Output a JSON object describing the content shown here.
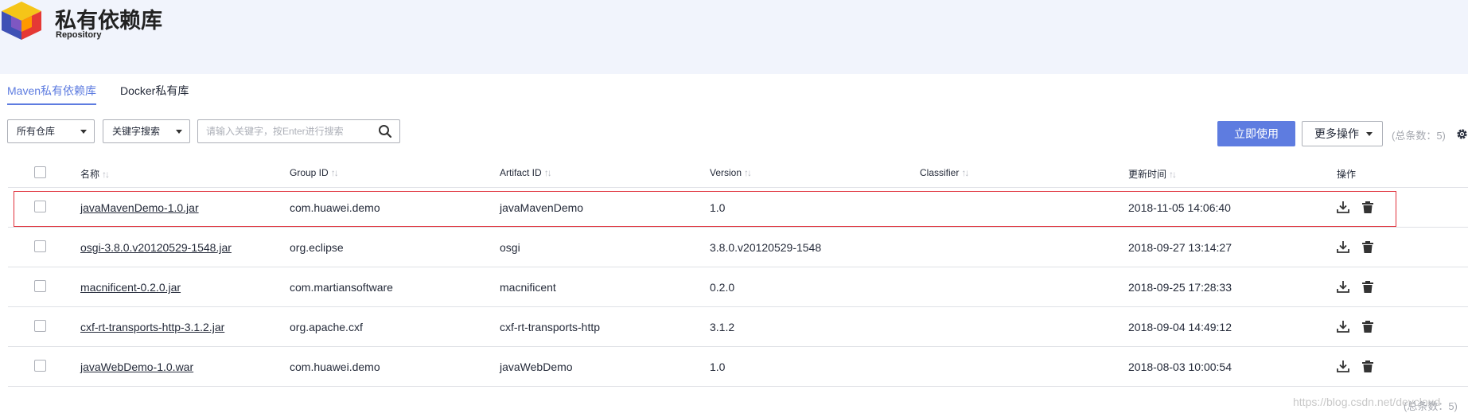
{
  "header": {
    "title": "私有依赖库",
    "subtitle": "Repository"
  },
  "tabs": [
    {
      "label": "Maven私有依赖库",
      "active": true
    },
    {
      "label": "Docker私有库",
      "active": false
    }
  ],
  "filters": {
    "repo_select": "所有仓库",
    "search_type_select": "关键字搜索",
    "search_placeholder": "请输入关键字，按Enter进行搜索"
  },
  "toolbar": {
    "primary_label": "立即使用",
    "more_label": "更多操作",
    "total_label": "(总条数：5)"
  },
  "table": {
    "columns": [
      "名称",
      "Group ID",
      "Artifact ID",
      "Version",
      "Classifier",
      "更新时间",
      "操作"
    ],
    "rows": [
      {
        "name": "javaMavenDemo-1.0.jar",
        "group": "com.huawei.demo",
        "artifact": "javaMavenDemo",
        "version": "1.0",
        "classifier": "",
        "updated": "2018-11-05 14:06:40"
      },
      {
        "name": "osgi-3.8.0.v20120529-1548.jar",
        "group": "org.eclipse",
        "artifact": "osgi",
        "version": "3.8.0.v20120529-1548",
        "classifier": "",
        "updated": "2018-09-27 13:14:27"
      },
      {
        "name": "macnificent-0.2.0.jar",
        "group": "com.martiansoftware",
        "artifact": "macnificent",
        "version": "0.2.0",
        "classifier": "",
        "updated": "2018-09-25 17:28:33"
      },
      {
        "name": "cxf-rt-transports-http-3.1.2.jar",
        "group": "org.apache.cxf",
        "artifact": "cxf-rt-transports-http",
        "version": "3.1.2",
        "classifier": "",
        "updated": "2018-09-04 14:49:12"
      },
      {
        "name": "javaWebDemo-1.0.war",
        "group": "com.huawei.demo",
        "artifact": "javaWebDemo",
        "version": "1.0",
        "classifier": "",
        "updated": "2018-08-03 10:00:54"
      }
    ]
  },
  "footer": {
    "total_label": "(总条数：5)"
  },
  "watermark": "https://blog.csdn.net/devcloud",
  "icons": {
    "download": "download-icon",
    "delete": "trash-icon",
    "settings": "gear-icon",
    "search": "search-icon"
  },
  "colors": {
    "accent": "#5e7ce0",
    "highlight": "#e0303b",
    "header_bg": "#f1f4fc"
  }
}
